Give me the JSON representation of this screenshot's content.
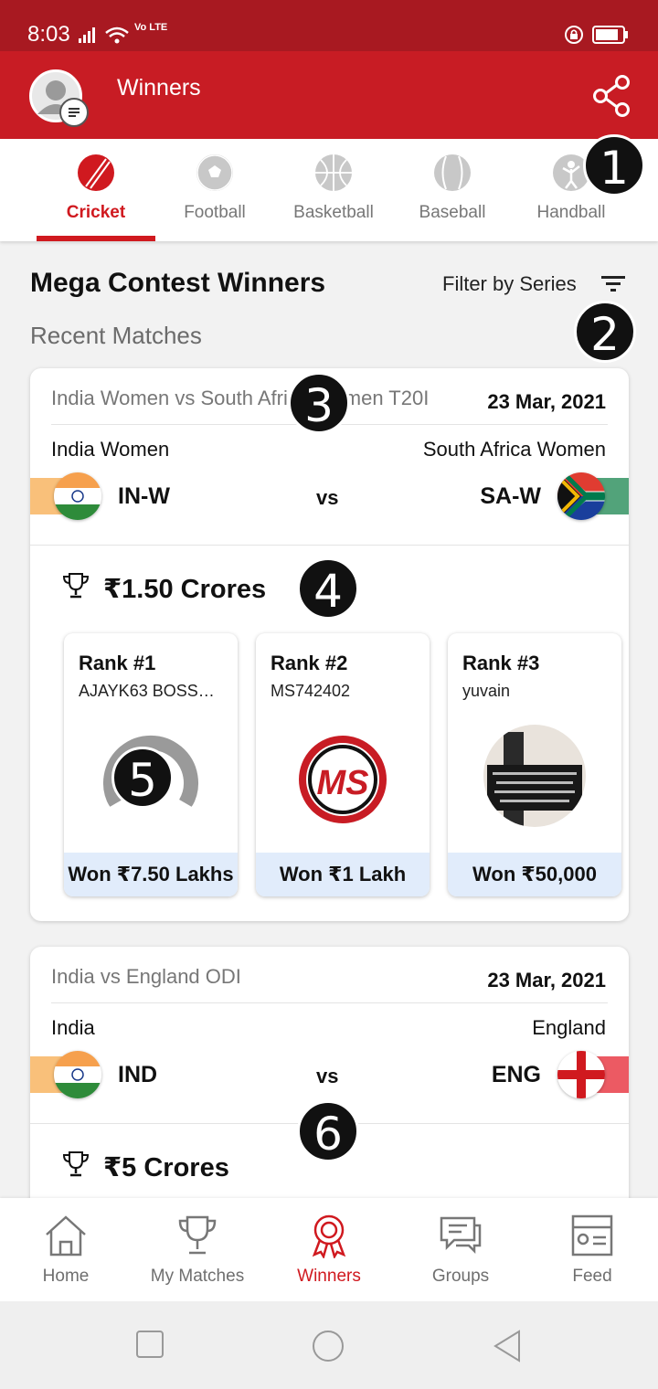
{
  "status_bar": {
    "time": "8:03",
    "network": "Vo LTE"
  },
  "app_bar": {
    "title": "Winners",
    "share_icon": "share-icon",
    "avatar_icon": "user-avatar-icon"
  },
  "sport_tabs": [
    {
      "label": "Cricket",
      "icon": "cricket-ball-icon",
      "active": true
    },
    {
      "label": "Football",
      "icon": "football-icon",
      "active": false
    },
    {
      "label": "Basketball",
      "icon": "basketball-icon",
      "active": false
    },
    {
      "label": "Baseball",
      "icon": "baseball-icon",
      "active": false
    },
    {
      "label": "Handball",
      "icon": "handball-icon",
      "active": false
    }
  ],
  "section": {
    "title": "Mega Contest Winners",
    "filter_label": "Filter by Series",
    "subtitle": "Recent Matches"
  },
  "markers": [
    "1",
    "2",
    "3",
    "4",
    "5",
    "6"
  ],
  "matches": [
    {
      "name": "India Women vs South Africa Women T20I",
      "date": "23 Mar, 2021",
      "team_left": "India Women",
      "team_right": "South Africa Women",
      "code_left": "IN-W",
      "code_right": "SA-W",
      "vs": "vs",
      "prize": "₹1.50 Crores",
      "winners": [
        {
          "rank": "Rank #1",
          "user": "AJAYK63 BOSS…",
          "won": "Won ₹7.50 Lakhs"
        },
        {
          "rank": "Rank #2",
          "user": "MS742402",
          "won": "Won ₹1 Lakh"
        },
        {
          "rank": "Rank #3",
          "user": "yuvain",
          "won": "Won ₹50,000"
        }
      ]
    },
    {
      "name": "India vs England ODI",
      "date": "23 Mar, 2021",
      "team_left": "India",
      "team_right": "England",
      "code_left": "IND",
      "code_right": "ENG",
      "vs": "vs",
      "prize": "₹5 Crores"
    }
  ],
  "bottom_nav": [
    {
      "label": "Home",
      "icon": "home-icon"
    },
    {
      "label": "My Matches",
      "icon": "trophy-icon"
    },
    {
      "label": "Winners",
      "icon": "rosette-icon",
      "active": true
    },
    {
      "label": "Groups",
      "icon": "chat-icon"
    },
    {
      "label": "Feed",
      "icon": "feed-icon"
    }
  ],
  "colors": {
    "brand_red": "#c81c24",
    "status_red": "#a81921",
    "active_red": "#d0191f",
    "won_bg": "#e1ecfb"
  }
}
